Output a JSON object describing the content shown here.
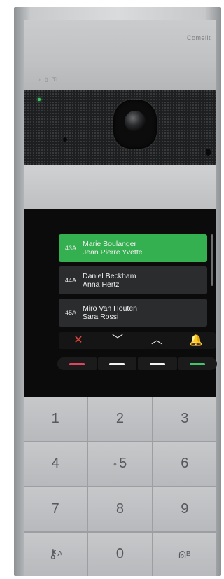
{
  "brand": "Comelit",
  "status_icons": [
    "hearing-icon",
    "accessibility-icon",
    "key-icon"
  ],
  "directory": [
    {
      "code": "43A",
      "line1": "Marie Boulanger",
      "line2": "Jean Pierre Yvette",
      "selected": true
    },
    {
      "code": "44A",
      "line1": "Daniel Beckham",
      "line2": "Anna Hertz",
      "selected": false
    },
    {
      "code": "45A",
      "line1": "Miro Van Houten",
      "line2": "Sara Rossi",
      "selected": false
    }
  ],
  "controls": {
    "cancel": "✕",
    "down": "﹀",
    "up": "︿",
    "call": "🔔"
  },
  "hw_key_colors": [
    "#e0445e",
    "#f2f2f2",
    "#f2f2f2",
    "#43c46a"
  ],
  "keypad": {
    "k1": "1",
    "k2": "2",
    "k3": "3",
    "k4": "4",
    "k5": "5",
    "k6": "6",
    "k7": "7",
    "k8": "8",
    "k9": "9",
    "key_a_label": "A",
    "k0": "0",
    "key_b_label": "B"
  }
}
